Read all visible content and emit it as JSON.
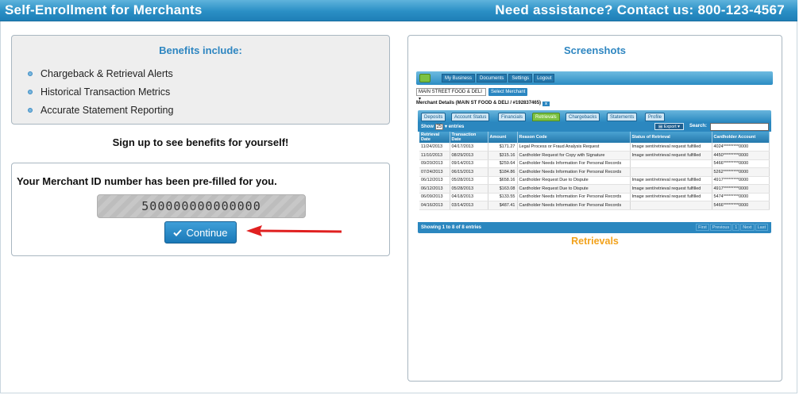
{
  "header": {
    "title": "Self-Enrollment for Merchants",
    "assistance": "Need assistance? Contact us: 800-123-4567"
  },
  "benefits": {
    "heading": "Benefits include:",
    "items": [
      "Chargeback & Retrieval Alerts",
      "Historical Transaction Metrics",
      "Accurate Statement Reporting"
    ]
  },
  "signup_text": "Sign up to see benefits for yourself!",
  "merchant": {
    "prefill_text": "Your Merchant ID number has been pre-filled for you.",
    "merchant_id": "500000000000000",
    "continue_label": "Continue"
  },
  "screenshots": {
    "heading": "Screenshots",
    "caption": "Retrievals",
    "mini": {
      "nav": [
        "My Business",
        "Documents",
        "Settings",
        "Logout"
      ],
      "merchant_select": "MAIN STREET FOOD & DELI",
      "select_button": "Select Merchant",
      "details": "Merchant Details (MAIN ST FOOD & DELI / #192837465)",
      "tabs": [
        "Deposits",
        "Account Status",
        "Financials",
        "Retrievals",
        "Chargebacks",
        "Statements",
        "Profile"
      ],
      "active_tab": "Retrievals",
      "show_label": "Show",
      "show_value": "25",
      "entries_label": "entries",
      "export_label": "Export",
      "search_label": "Search:",
      "columns": [
        "Retrieval Date",
        "Transaction Date",
        "Amount",
        "Reason Code",
        "Status of Retrieval",
        "Cardholder Account"
      ],
      "rows": [
        [
          "11/24/2013",
          "04/17/2013",
          "$171.27",
          "Legal Process or Fraud Analysis Request",
          "Image sent/retrieval request fulfilled",
          "4024*********0000"
        ],
        [
          "11/10/2013",
          "08/29/2013",
          "$315.16",
          "Cardholder Request for Copy with Signature",
          "Image sent/retrieval request fulfilled",
          "4450*********0000"
        ],
        [
          "09/20/2013",
          "09/14/2013",
          "$259.64",
          "Cardholder Needs Information For Personal Records",
          "",
          "5466*********0000"
        ],
        [
          "07/24/2013",
          "06/15/2013",
          "$184.86",
          "Cardholder Needs Information For Personal Records",
          "",
          "5262*********0000"
        ],
        [
          "06/12/2013",
          "05/28/2013",
          "$658.16",
          "Cardholder Request Due to Dispute",
          "Image sent/retrieval request fulfilled",
          "4917*********0000"
        ],
        [
          "06/12/2013",
          "05/28/2013",
          "$163.08",
          "Cardholder Request Due to Dispute",
          "Image sent/retrieval request fulfilled",
          "4917*********0000"
        ],
        [
          "06/09/2013",
          "04/18/2013",
          "$133.55",
          "Cardholder Needs Information For Personal Records",
          "Image sent/retrieval request fulfilled",
          "5474*********0000"
        ],
        [
          "04/16/2013",
          "03/14/2013",
          "$487.41",
          "Cardholder Needs Information For Personal Records",
          "",
          "5466*********0000"
        ]
      ],
      "footer": "Showing 1 to 8 of 8 entries",
      "pager": [
        "First",
        "Previous",
        "1",
        "Next",
        "Last"
      ]
    }
  },
  "colors": {
    "accent_blue": "#2e86c1",
    "caption_orange": "#f2a21c",
    "arrow_red": "#e02020"
  }
}
